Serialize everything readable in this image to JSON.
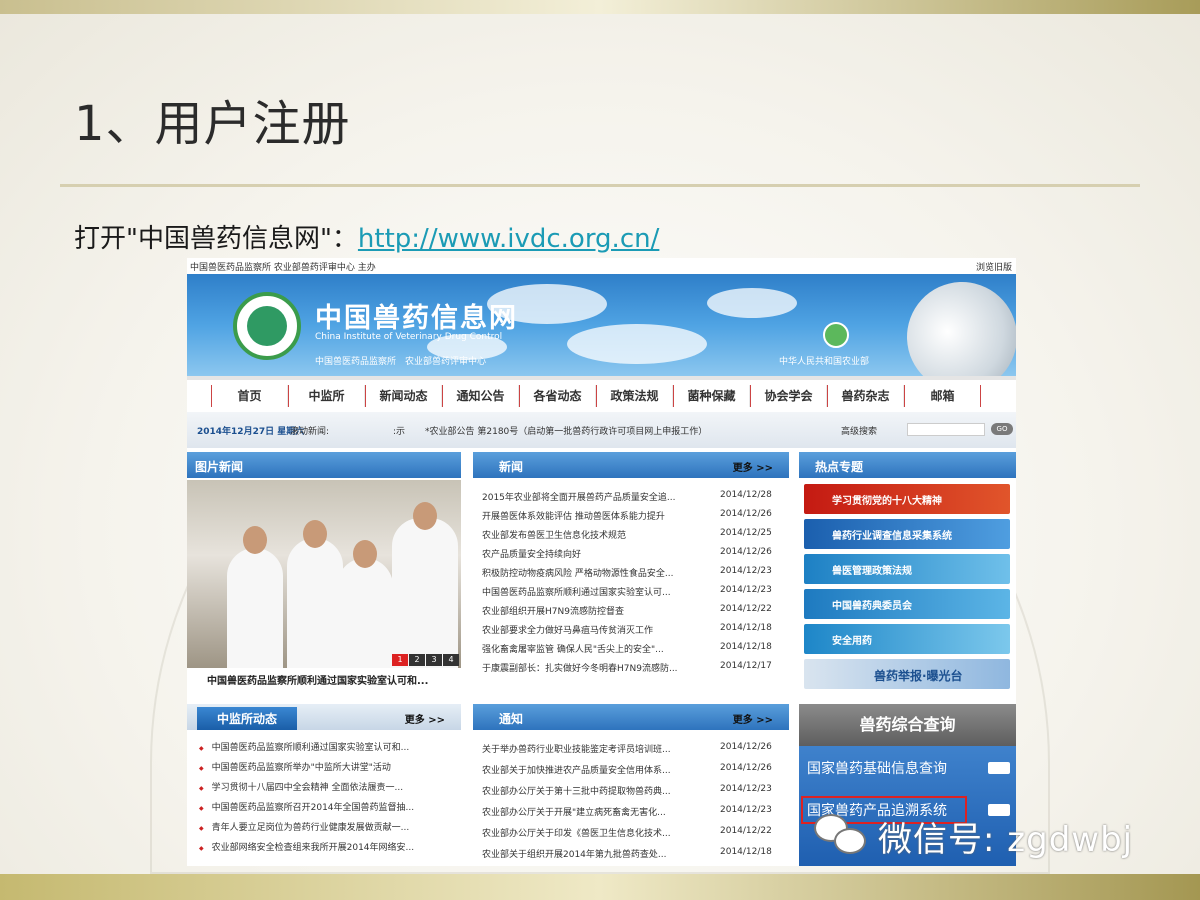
{
  "slide": {
    "title": "1、用户注册",
    "intro_prefix": "打开\"中国兽药信息网\"：",
    "intro_link": "http://www.ivdc.org.cn/"
  },
  "site": {
    "top_left": "中国兽医药品监察所 农业部兽药评审中心 主办",
    "top_right": "浏览旧版",
    "name_cn": "中国兽药信息网",
    "name_en_1": "China Institute of Veterinary Drug Control",
    "subtitle": "中国兽医药品监察所　农业部兽药评审中心",
    "ministry": "中华人民共和国农业部",
    "nav": [
      "首页",
      "中监所",
      "新闻动态",
      "通知公告",
      "各省动态",
      "政策法规",
      "菌种保藏",
      "协会学会",
      "兽药杂志",
      "邮箱"
    ],
    "ticker": {
      "date": "2014年12月27日 星期六",
      "label": "滚动新闻:",
      "sep": ":示",
      "news": "*农业部公告 第2180号（启动第一批兽药行政许可项目网上申报工作）",
      "advanced": "高级搜索",
      "go": "GO"
    },
    "photo_panel": {
      "header": "图片新闻",
      "pages": [
        "1",
        "2",
        "3",
        "4"
      ],
      "caption": "中国兽医药品监察所顺利通过国家实验室认可和..."
    },
    "news_panel": {
      "header": "新闻",
      "more": "更多 >>",
      "items": [
        {
          "t": "2015年农业部将全面开展兽药产品质量安全追...",
          "d": "2014/12/28"
        },
        {
          "t": "开展兽医体系效能评估 推动兽医体系能力提升",
          "d": "2014/12/26"
        },
        {
          "t": "农业部发布兽医卫生信息化技术规范",
          "d": "2014/12/25"
        },
        {
          "t": "农产品质量安全持续向好",
          "d": "2014/12/26"
        },
        {
          "t": "积极防控动物疫病风险 严格动物源性食品安全...",
          "d": "2014/12/23"
        },
        {
          "t": "中国兽医药品监察所顺利通过国家实验室认可...",
          "d": "2014/12/23"
        },
        {
          "t": "农业部组织开展H7N9流感防控督查",
          "d": "2014/12/22"
        },
        {
          "t": "农业部要求全力做好马鼻疽马传贫消灭工作",
          "d": "2014/12/18"
        },
        {
          "t": "强化畜禽屠宰监管 确保人民\"舌尖上的安全\"...",
          "d": "2014/12/18"
        },
        {
          "t": "于康震副部长：扎实做好今冬明春H7N9流感防...",
          "d": "2014/12/17"
        }
      ]
    },
    "hot_panel": {
      "header": "热点专题",
      "items": [
        "学习贯彻党的十八大精神",
        "兽药行业调查信息采集系统",
        "兽医管理政策法规",
        "中国兽药典委员会",
        "安全用药",
        "兽药举报·曝光台"
      ]
    },
    "dyn_panel": {
      "header": "中监所动态",
      "more": "更多 >>",
      "items": [
        "中国兽医药品监察所顺利通过国家实验室认可和...",
        "中国兽医药品监察所举办\"中监所大讲堂\"活动",
        "学习贯彻十八届四中全会精神 全面依法履责一...",
        "中国兽医药品监察所召开2014年全国兽药监督抽...",
        "青年人要立足岗位为兽药行业健康发展做贡献一...",
        "农业部网络安全检查组来我所开展2014年网络安..."
      ]
    },
    "notice_panel": {
      "header": "通知",
      "more": "更多 >>",
      "items": [
        {
          "t": "关于举办兽药行业职业技能鉴定考评员培训班...",
          "d": "2014/12/26"
        },
        {
          "t": "农业部关于加快推进农产品质量安全信用体系...",
          "d": "2014/12/26"
        },
        {
          "t": "农业部办公厅关于第十三批中药提取物兽药典...",
          "d": "2014/12/23"
        },
        {
          "t": "农业部办公厅关于开展\"建立病死畜禽无害化...",
          "d": "2014/12/23"
        },
        {
          "t": "农业部办公厅关于印发《兽医卫生信息化技术...",
          "d": "2014/12/22"
        },
        {
          "t": "农业部关于组织开展2014年第九批兽药查处...",
          "d": "2014/12/18"
        }
      ]
    },
    "query_panel": {
      "header": "兽药综合查询",
      "items": [
        "国家兽药基础信息查询",
        "国家兽药产品追溯系统"
      ]
    }
  },
  "watermark": "微信号: zgdwbj"
}
